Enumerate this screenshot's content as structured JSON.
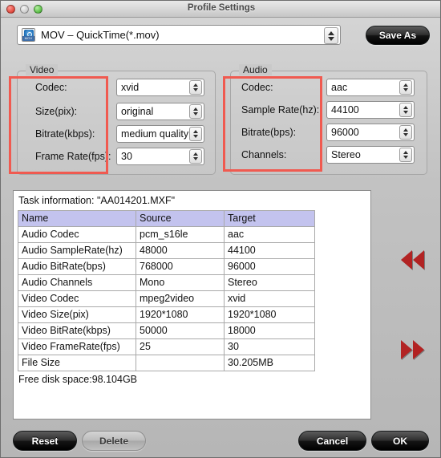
{
  "window": {
    "title": "Profile Settings",
    "traffic_lights": [
      "close",
      "minimize",
      "zoom"
    ]
  },
  "profile": {
    "icon": "mov-quicktime-icon",
    "icon_label": "MOV",
    "selected": "MOV – QuickTime(*.mov)",
    "save_as_label": "Save As"
  },
  "video": {
    "group_label": "Video",
    "fields": [
      {
        "label": "Codec:",
        "value": "xvid"
      },
      {
        "label": "Size(pix):",
        "value": "original"
      },
      {
        "label": "Bitrate(kbps):",
        "value": "medium quality"
      },
      {
        "label": "Frame Rate(fps):",
        "value": "30"
      }
    ]
  },
  "audio": {
    "group_label": "Audio",
    "fields": [
      {
        "label": "Codec:",
        "value": "aac"
      },
      {
        "label": "Sample Rate(hz):",
        "value": "44100"
      },
      {
        "label": "Bitrate(bps):",
        "value": "96000"
      },
      {
        "label": "Channels:",
        "value": "Stereo"
      }
    ]
  },
  "highlight_color": "#f05a50",
  "task_info": {
    "title": "Task information: \"AA014201.MXF\"",
    "columns": [
      "Name",
      "Source",
      "Target"
    ],
    "rows": [
      [
        "Audio Codec",
        "pcm_s16le",
        "aac"
      ],
      [
        "Audio SampleRate(hz)",
        "48000",
        "44100"
      ],
      [
        "Audio BitRate(bps)",
        "768000",
        "96000"
      ],
      [
        "Audio Channels",
        "Mono",
        "Stereo"
      ],
      [
        "Video Codec",
        "mpeg2video",
        "xvid"
      ],
      [
        "Video Size(pix)",
        "1920*1080",
        "1920*1080"
      ],
      [
        "Video BitRate(kbps)",
        "50000",
        "18000"
      ],
      [
        "Video FrameRate(fps)",
        "25",
        "30"
      ],
      [
        "File Size",
        "",
        "30.205MB"
      ]
    ],
    "disk_space": "Free disk space:98.104GB"
  },
  "nav": {
    "rewind_icon": "double-left-arrow-icon",
    "forward_icon": "double-right-arrow-icon",
    "arrow_color": "#b22323"
  },
  "buttons": {
    "reset": "Reset",
    "delete": "Delete",
    "cancel": "Cancel",
    "ok": "OK"
  }
}
